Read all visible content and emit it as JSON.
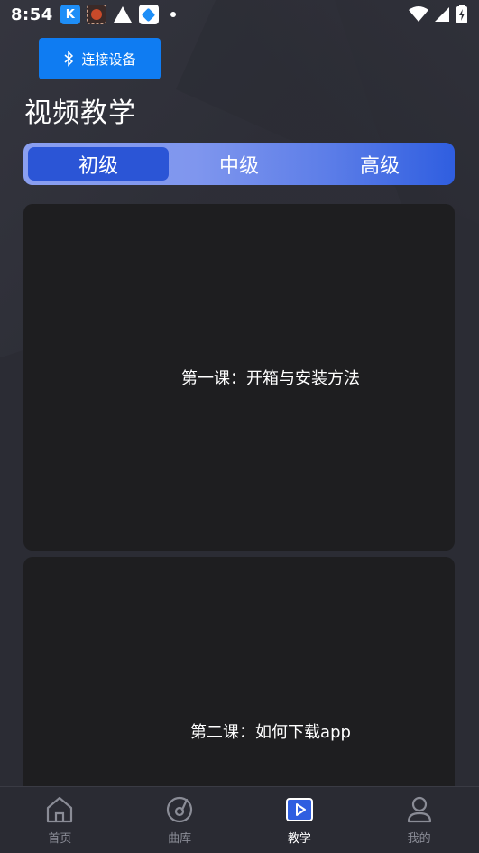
{
  "status_bar": {
    "time": "8:54"
  },
  "connect_button": {
    "label": "连接设备"
  },
  "page_title": "视频教学",
  "level_tabs": [
    {
      "label": "初级",
      "active": true
    },
    {
      "label": "中级",
      "active": false
    },
    {
      "label": "高级",
      "active": false
    }
  ],
  "videos": [
    {
      "title": "第一课：开箱与安装方法"
    },
    {
      "title": "第二课：如何下载app"
    }
  ],
  "bottom_nav": [
    {
      "label": "首页",
      "icon": "home-icon",
      "active": false
    },
    {
      "label": "曲库",
      "icon": "music-disc-icon",
      "active": false
    },
    {
      "label": "教学",
      "icon": "video-play-icon",
      "active": true
    },
    {
      "label": "我的",
      "icon": "profile-icon",
      "active": false
    }
  ],
  "colors": {
    "background": "#2b2c34",
    "accent": "#0f7cf2",
    "tab_active": "#2b55d6",
    "card": "#1e1e20"
  }
}
